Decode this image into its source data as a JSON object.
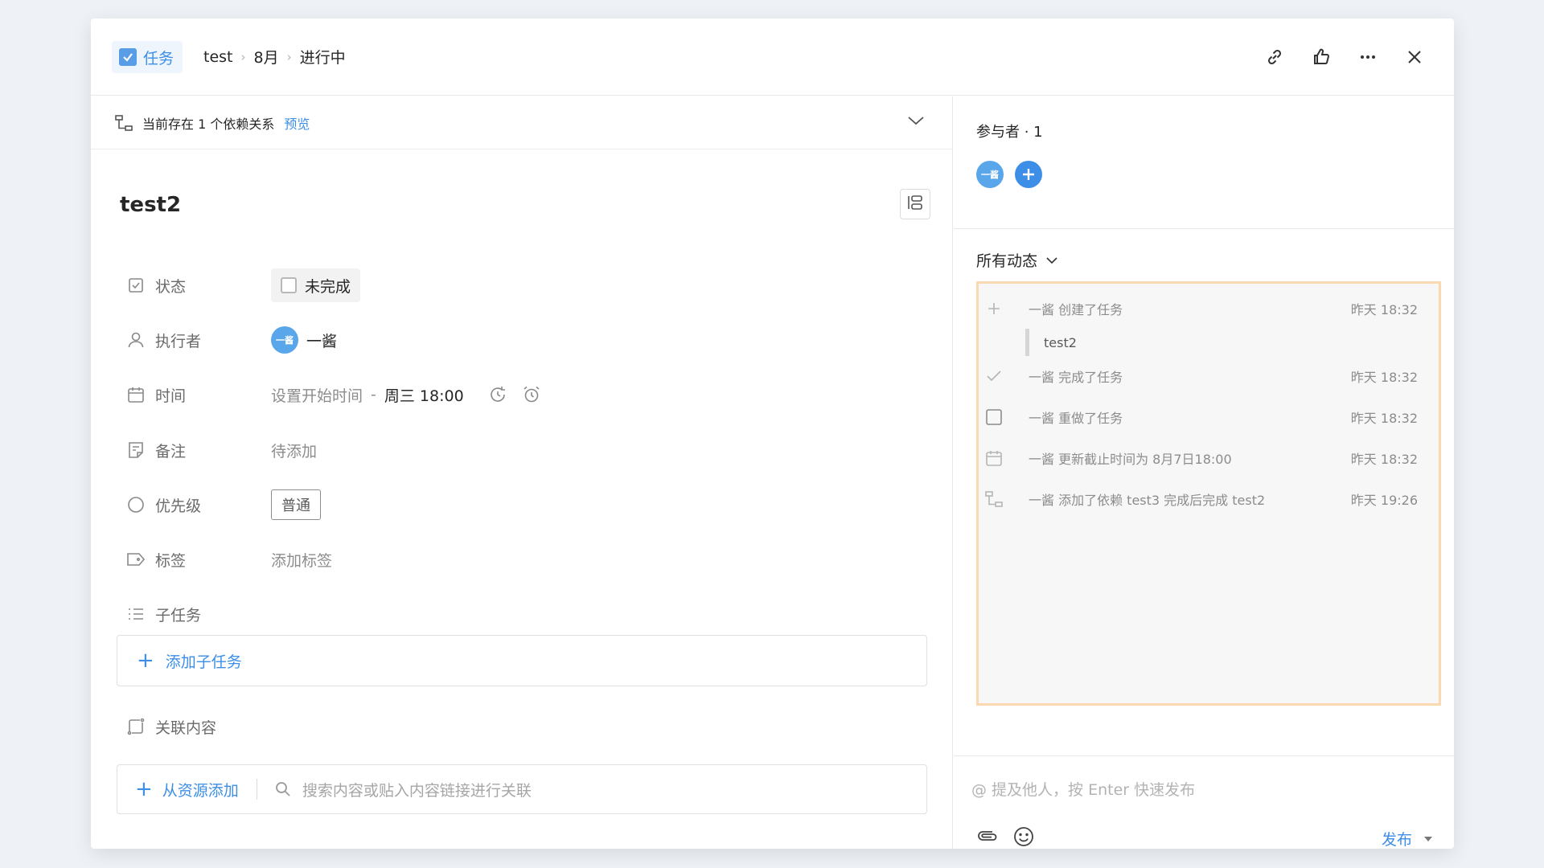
{
  "header": {
    "type_label": "任务",
    "breadcrumb": [
      "test",
      "8月",
      "进行中"
    ],
    "actions": [
      "link-icon",
      "thumbs-up-icon",
      "more-icon",
      "close-icon"
    ]
  },
  "dependency": {
    "text": "当前存在 1 个依赖关系",
    "preview": "预览"
  },
  "task": {
    "title": "test2",
    "fields": {
      "status_label": "状态",
      "status_value": "未完成",
      "assignee_label": "执行者",
      "assignee_avatar": "一酱",
      "assignee_name": "一酱",
      "time_label": "时间",
      "start_placeholder": "设置开始时间",
      "time_sep": "-",
      "due": "周三 18:00",
      "note_label": "备注",
      "note_value": "待添加",
      "priority_label": "优先级",
      "priority_value": "普通",
      "tag_label": "标签",
      "tag_value": "添加标签",
      "subtask_label": "子任务",
      "add_subtask": "添加子任务",
      "related_label": "关联内容",
      "add_from_resource": "从资源添加",
      "related_search_placeholder": "搜索内容或贴入内容链接进行关联"
    }
  },
  "participants": {
    "title": "参与者 · 1",
    "avatar": "一酱"
  },
  "activity": {
    "filter_label": "所有动态",
    "items": [
      {
        "icon": "plus-icon",
        "text": "一酱 创建了任务",
        "time": "昨天 18:32",
        "quote": "test2"
      },
      {
        "icon": "check-icon",
        "text": "一酱 完成了任务",
        "time": "昨天 18:32"
      },
      {
        "icon": "checkbox-icon",
        "text": "一酱 重做了任务",
        "time": "昨天 18:32"
      },
      {
        "icon": "calendar-icon",
        "text": "一酱 更新截止时间为 8月7日18:00",
        "time": "昨天 18:32"
      },
      {
        "icon": "dependency-icon",
        "text": "一酱 添加了依赖 test3 完成后完成 test2",
        "time": "昨天 19:26"
      }
    ]
  },
  "comment": {
    "placeholder": "@ 提及他人，按 Enter 快速发布",
    "publish": "发布"
  },
  "colors": {
    "accent": "#3d8ee7",
    "avatar": "#5aa6ea",
    "activity_border": "#fbd9b0"
  }
}
